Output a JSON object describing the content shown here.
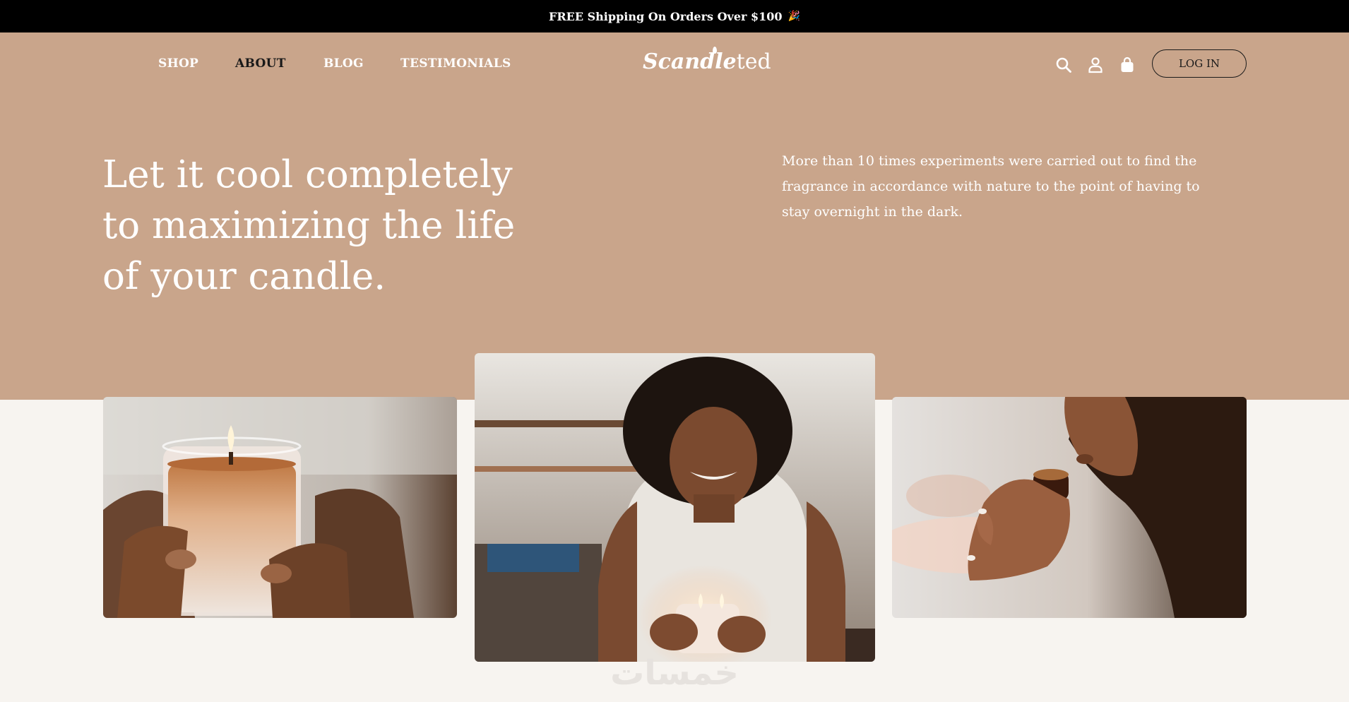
{
  "announcement": {
    "text": "FREE Shipping On Orders Over $100",
    "emoji": "🎉"
  },
  "nav": {
    "links": [
      {
        "label": "SHOP"
      },
      {
        "label": "ABOUT"
      },
      {
        "label": "BLOG"
      },
      {
        "label": "TESTIMONIALS"
      }
    ],
    "logo": {
      "script": "Scandle",
      "rest": "ted"
    },
    "icons": [
      "search-icon",
      "user-icon",
      "bag-icon"
    ],
    "login_label": "LOG IN"
  },
  "hero": {
    "headline": "Let it cool completely to maximizing the life of your candle.",
    "intro": "More than 10 times experiments were carried out to find the fragrance in accordance with nature to the point of having to stay overnight in the dark."
  },
  "colors": {
    "hero_bg": "#c9a58b",
    "page_bg": "#f7f4f0",
    "announce_bg": "#000000",
    "text_light": "#ffffff",
    "text_dark": "#1a1a1a"
  },
  "watermark": "خمسات"
}
